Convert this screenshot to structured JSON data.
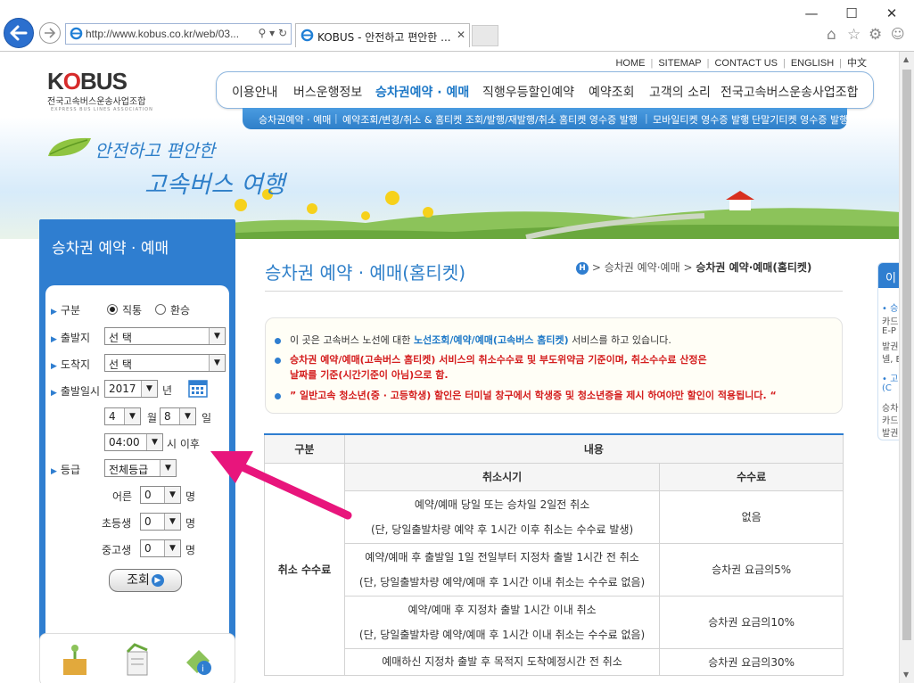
{
  "browser": {
    "url": "http://www.kobus.co.kr/web/03...",
    "tab_title": "KOBUS - 안전하고 편안한 ...",
    "search_icon": "search-icon",
    "refresh_icon": "refresh-icon"
  },
  "header": {
    "logo_text_1": "K",
    "logo_text_o": "O",
    "logo_text_2": "BUS",
    "logo_org": "전국고속버스운송사업조합",
    "logo_org_en": "EXPRESS BUS LINES ASSOCIATION",
    "top_links": [
      "HOME",
      "SITEMAP",
      "CONTACT US",
      "ENGLISH",
      "中文"
    ],
    "main_nav": [
      "이용안내",
      "버스운행정보",
      "승차권예약 · 예매",
      "직행우등할인예약",
      "예약조회",
      "고객의 소리",
      "전국고속버스운송사업조합"
    ],
    "sub_nav": [
      "승차권예약 · 예매",
      "예약조회/변경/취소 & 홈티켓 조회/발행/재발행/취소",
      "홈티켓 영수증 발행",
      "모바일티켓 영수증 발행",
      "단말기티켓 영수증 발행"
    ],
    "slogan_line1": "안전하고 편안한",
    "slogan_line2": "고속버스 여행"
  },
  "left_panel": {
    "title": "승차권 예약 · 예매",
    "labels": {
      "type": "구분",
      "origin": "출발지",
      "destination": "도착지",
      "depart_date": "출발일시",
      "grade": "등급"
    },
    "type_options": [
      "직통",
      "환승"
    ],
    "origin_value": "선          택",
    "destination_value": "선          택",
    "year": "2017",
    "year_unit": "년",
    "month": "4",
    "month_unit": "월",
    "day": "8",
    "day_unit": "일",
    "time": "04:00",
    "time_unit": "시 이후",
    "grade_value": "전체등급",
    "passengers": [
      {
        "label": "어른",
        "value": "0",
        "unit": "명"
      },
      {
        "label": "초등생",
        "value": "0",
        "unit": "명"
      },
      {
        "label": "중고생",
        "value": "0",
        "unit": "명"
      }
    ],
    "search_label": "조회"
  },
  "content": {
    "page_title": "승차권 예약 · 예매(홈티켓)",
    "breadcrumb_home": "H",
    "breadcrumb_1": "승차권 예약·예매",
    "breadcrumb_2": "승차권 예약·예매(홈티켓)",
    "notice": {
      "l1_pre": "이 곳은 고속버스 노선에 대한 ",
      "l1_hl": "노선조회/예약/예매(고속버스 홈티켓)",
      "l1_post": " 서비스를 하고 있습니다.",
      "l2a": "승차권 예약/예매(고속버스 홈티켓) 서비스의 취소수수료 및 부도위약금 기준이며, 취소수수료 산정은",
      "l2b": "날짜를 기준(시간기준이 아님)으로 함.",
      "l3": "” 일반고속 청소년(중 · 고등학생) 할인은 터미널 창구에서 학생증 및 청소년증을 제시 하여야만 할인이 적용됩니다. “"
    },
    "table": {
      "h_category": "구분",
      "h_content": "내용",
      "h_period": "취소시기",
      "h_fee": "수수료",
      "category": "취소 수수료",
      "rows": [
        {
          "l1": "예약/예매 당일 또는 승차일 2일전 취소",
          "l2": "(단, 당일출발차량 예약 후 1시간 이후 취소는 수수료 발생)",
          "fee": "없음"
        },
        {
          "l1": "예약/예매 후 출발일 1일 전일부터 지정차 출발 1시간 전 취소",
          "l2": "(단, 당일출발차량 예약/예매 후 1시간 이내 취소는 수수료 없음)",
          "fee": "승차권 요금의5%"
        },
        {
          "l1": "예약/예매 후 지정차 출발 1시간 이내 취소",
          "l2": "(단, 당일출발차량 예약/예매 후 1시간 이내 취소는 수수료 없음)",
          "fee": "승차권 요금의10%"
        },
        {
          "l1": "예매하신 지정차 출발 후 목적지 도착예정시간 전 취소",
          "l2": "",
          "fee": "승차권 요금의30%"
        }
      ]
    }
  },
  "side_box": {
    "title": "이",
    "t1": "• 승",
    "t2": "카드",
    "t3": "E-P",
    "t4": "발권",
    "t5": "넬, E",
    "t6": "• 고",
    "t7": "(C",
    "t8": "승차",
    "t9": "카드",
    "t10": "발권"
  },
  "colors": {
    "primary": "#2f7ed0",
    "accent_red": "#d41d1d",
    "arrow": "#e8157c"
  }
}
